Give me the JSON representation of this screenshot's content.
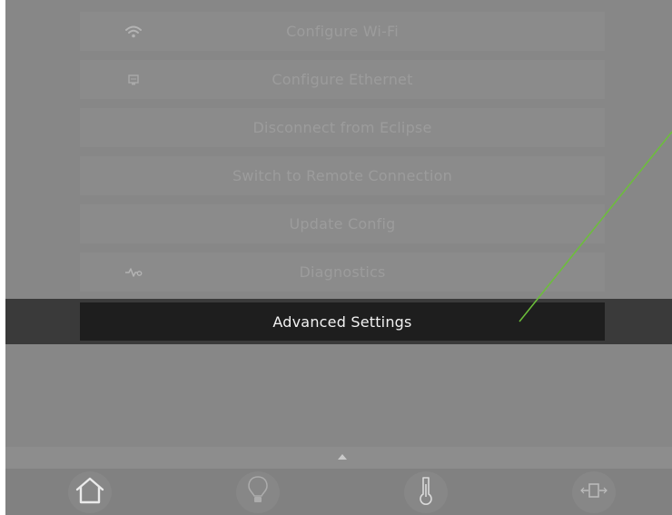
{
  "menu": {
    "items": [
      {
        "label": "Configure Wi-Fi",
        "icon": "wifi-icon"
      },
      {
        "label": "Configure Ethernet",
        "icon": "ethernet-icon"
      },
      {
        "label": "Disconnect from Eclipse",
        "icon": null
      },
      {
        "label": "Switch to Remote Connection",
        "icon": null
      },
      {
        "label": "Update Config",
        "icon": null
      },
      {
        "label": "Diagnostics",
        "icon": "pulse-icon"
      }
    ],
    "selected": {
      "label": "Advanced Settings"
    }
  },
  "footer": {
    "tabs": [
      {
        "name": "home",
        "icon": "home-icon"
      },
      {
        "name": "lighting",
        "icon": "lightbulb-icon"
      },
      {
        "name": "climate",
        "icon": "thermometer-icon"
      },
      {
        "name": "shades",
        "icon": "shade-icon"
      }
    ]
  },
  "colors": {
    "screen_bg": "#878787",
    "button_bg": "#8b8b8b",
    "button_text_dim": "#9c9c9c",
    "selected_bg": "#1e1e1e",
    "selected_text": "#f2f2f2",
    "annotation_line": "#6cbf3a"
  }
}
